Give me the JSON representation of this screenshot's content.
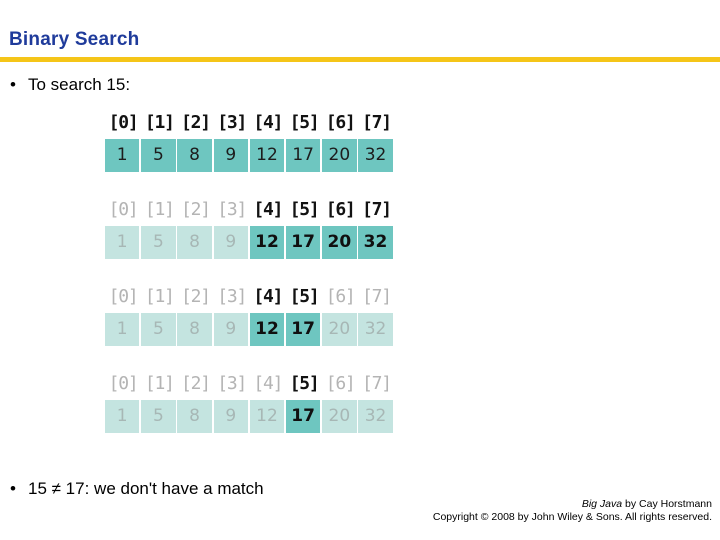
{
  "slide": {
    "title": "Binary Search",
    "accent_rule_color": "#f5c518",
    "title_color": "#1f3b9b"
  },
  "bullets": {
    "marker": "•",
    "top": "To search 15:",
    "bottom": "15 ≠ 17: we don't have a match"
  },
  "array_colors": {
    "active_cell_bg": "#6ec6c0",
    "dim_cell_bg": "#c4e4e0",
    "active_text": "#101010",
    "dim_text": "#a7b7b5",
    "active_index_text": "#121212",
    "dim_index_text": "#b4b4b4"
  },
  "array_rows": [
    {
      "indices": [
        "[0]",
        "[1]",
        "[2]",
        "[3]",
        "[4]",
        "[5]",
        "[6]",
        "[7]"
      ],
      "values": [
        "1",
        "5",
        "8",
        "9",
        "12",
        "17",
        "20",
        "32"
      ],
      "index_states": [
        "active",
        "active",
        "active",
        "active",
        "active",
        "active",
        "active",
        "active"
      ],
      "value_states": [
        "full",
        "full",
        "full",
        "full",
        "full",
        "full",
        "full",
        "full"
      ]
    },
    {
      "indices": [
        "[0]",
        "[1]",
        "[2]",
        "[3]",
        "[4]",
        "[5]",
        "[6]",
        "[7]"
      ],
      "values": [
        "1",
        "5",
        "8",
        "9",
        "12",
        "17",
        "20",
        "32"
      ],
      "index_states": [
        "dim",
        "dim",
        "dim",
        "dim",
        "active",
        "active",
        "active",
        "active"
      ],
      "value_states": [
        "dim",
        "dim",
        "dim",
        "dim",
        "active",
        "active",
        "active",
        "active"
      ]
    },
    {
      "indices": [
        "[0]",
        "[1]",
        "[2]",
        "[3]",
        "[4]",
        "[5]",
        "[6]",
        "[7]"
      ],
      "values": [
        "1",
        "5",
        "8",
        "9",
        "12",
        "17",
        "20",
        "32"
      ],
      "index_states": [
        "dim",
        "dim",
        "dim",
        "dim",
        "active",
        "active",
        "dim",
        "dim"
      ],
      "value_states": [
        "dim",
        "dim",
        "dim",
        "dim",
        "active",
        "active",
        "dim",
        "dim"
      ]
    },
    {
      "indices": [
        "[0]",
        "[1]",
        "[2]",
        "[3]",
        "[4]",
        "[5]",
        "[6]",
        "[7]"
      ],
      "values": [
        "1",
        "5",
        "8",
        "9",
        "12",
        "17",
        "20",
        "32"
      ],
      "index_states": [
        "dim",
        "dim",
        "dim",
        "dim",
        "dim",
        "active",
        "dim",
        "dim"
      ],
      "value_states": [
        "dim",
        "dim",
        "dim",
        "dim",
        "dim",
        "active",
        "dim",
        "dim"
      ]
    }
  ],
  "footer": {
    "book_title": "Big Java",
    "byline": " by Cay Horstmann",
    "copyright": "Copyright © 2008 by John Wiley & Sons.  All rights reserved."
  }
}
